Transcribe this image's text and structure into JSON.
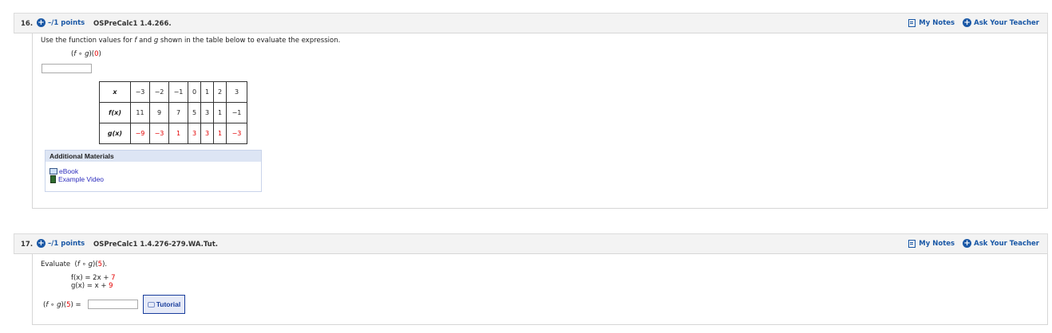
{
  "q16": {
    "number": "16.",
    "points": "–/1 points",
    "code": "OSPreCalc1 1.4.266.",
    "my_notes": "My Notes",
    "ask_teacher": "Ask Your Teacher",
    "prompt_pre": "Use the function values for ",
    "prompt_f": "f",
    "prompt_mid": " and ",
    "prompt_g": "g",
    "prompt_post": " shown in the table below to evaluate the expression.",
    "expr_open": "(",
    "expr_f": "f",
    "expr_circ": " ∘ ",
    "expr_g": "g",
    "expr_close": ")(",
    "expr_val": "0",
    "expr_end": ")",
    "table": {
      "x_label": "x",
      "f_label": "f(x)",
      "g_label": "g(x)",
      "x": [
        "−3",
        "−2",
        "−1",
        "0",
        "1",
        "2",
        "3"
      ],
      "f": [
        "11",
        "9",
        "7",
        "5",
        "3",
        "1",
        "−1"
      ],
      "g": [
        "−9",
        "−3",
        "1",
        "3",
        "3",
        "1",
        "−3"
      ]
    },
    "additional_materials": "Additional Materials",
    "ebook": "eBook",
    "example_video": "Example Video"
  },
  "q17": {
    "number": "17.",
    "points": "–/1 points",
    "code": "OSPreCalc1 1.4.276-279.WA.Tut.",
    "my_notes": "My Notes",
    "ask_teacher": "Ask Your Teacher",
    "evaluate": "Evaluate",
    "expr_f": "f",
    "expr_circ": " ∘ ",
    "expr_g": "g",
    "expr_val": "5",
    "fx_lhs": "f(x) = 2x + ",
    "fx_const": "7",
    "gx_lhs": "g(x) = x + ",
    "gx_const": "9",
    "answer_lhs_end": ") =",
    "tutorial": "Tutorial"
  }
}
